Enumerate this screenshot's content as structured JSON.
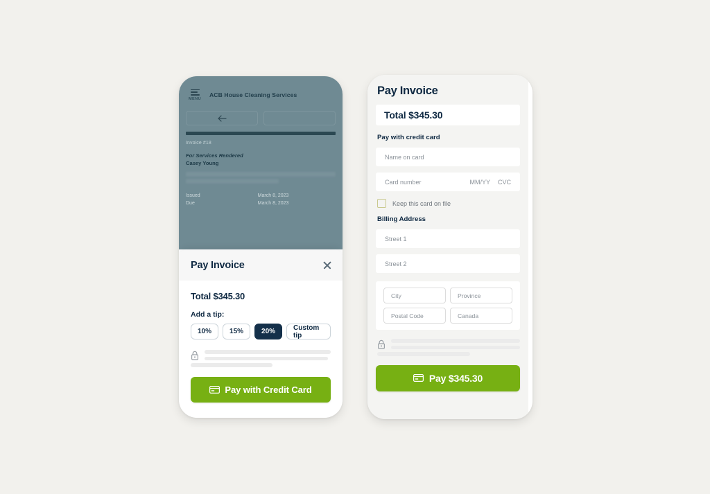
{
  "theme": {
    "page_background": "#f2f1ed",
    "brand_green": "#77b013",
    "navy": "#102a43",
    "selected_chip_bg": "#14304a",
    "invoice_overlay": "#6f8a93",
    "checkbox_border": "#c9c98e"
  },
  "left_phone": {
    "invoice_screen": {
      "menu_icon": "hamburger-menu-icon",
      "menu_label": "MENU",
      "business_name": "ACB House Cleaning Services",
      "back_button_icon": "arrow-left-icon",
      "secondary_button_label": "",
      "invoice_number": "Invoice #18",
      "invoice_for": "For Services Rendered",
      "client_name": "Casey Young",
      "dates": [
        {
          "label": "Issued",
          "value": "March 8, 2023"
        },
        {
          "label": "Due",
          "value": "March 8, 2023"
        }
      ]
    },
    "sheet": {
      "title": "Pay Invoice",
      "close_icon": "close-icon",
      "total_label": "Total $345.30",
      "tip_label": "Add a tip:",
      "tip_options": [
        {
          "label": "10%",
          "selected": false
        },
        {
          "label": "15%",
          "selected": false
        },
        {
          "label": "20%",
          "selected": true
        },
        {
          "label": "Custom tip",
          "selected": false
        }
      ],
      "secure_icon": "padlock-icon",
      "pay_button": {
        "icon": "credit-card-icon",
        "label": "Pay with Credit Card"
      }
    }
  },
  "right_phone": {
    "title": "Pay Invoice",
    "total_label": "Total $345.30",
    "credit_card_section_label": "Pay with credit card",
    "name_on_card_placeholder": "Name on card",
    "card_number_placeholder": "Card number",
    "expiry_placeholder": "MM/YY",
    "cvc_placeholder": "CVC",
    "keep_card_checkbox_label": "Keep this card on file",
    "keep_card_checked": false,
    "billing_address_label": "Billing Address",
    "street1_placeholder": "Street 1",
    "street2_placeholder": "Street 2",
    "city_placeholder": "City",
    "province_placeholder": "Province",
    "postal_code_placeholder": "Postal Code",
    "country_value": "Canada",
    "secure_icon": "padlock-icon",
    "pay_button": {
      "icon": "credit-card-icon",
      "label": "Pay $345.30"
    }
  }
}
